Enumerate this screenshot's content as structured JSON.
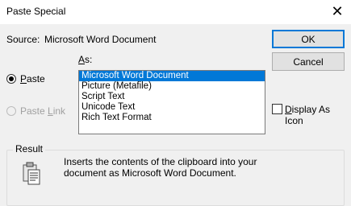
{
  "window": {
    "title": "Paste Special",
    "close_glyph": "✕"
  },
  "source": {
    "label": "Source:",
    "value": "Microsoft Word Document"
  },
  "as_label": {
    "accel": "A",
    "rest": "s:"
  },
  "paste_options": {
    "paste": {
      "accel": "P",
      "rest": "aste",
      "checked": true
    },
    "paste_link": {
      "prefix": "Paste ",
      "accel": "L",
      "rest": "ink",
      "enabled": false
    }
  },
  "formats": [
    "Microsoft Word Document",
    "Picture (Metafile)",
    "Script Text",
    "Unicode Text",
    "Rich Text Format"
  ],
  "selected_format": "Microsoft Word Document",
  "buttons": {
    "ok": "OK",
    "cancel": "Cancel"
  },
  "display_as_icon": {
    "accel": "D",
    "rest": "isplay As Icon",
    "checked": false
  },
  "result": {
    "legend": "Result",
    "line1": "Inserts the contents of the clipboard into your",
    "line2": "document as Microsoft Word Document.",
    "icon": "clipboard-icon"
  },
  "colors": {
    "selection": "#0078d7",
    "default_button_border": "#0078d7"
  }
}
